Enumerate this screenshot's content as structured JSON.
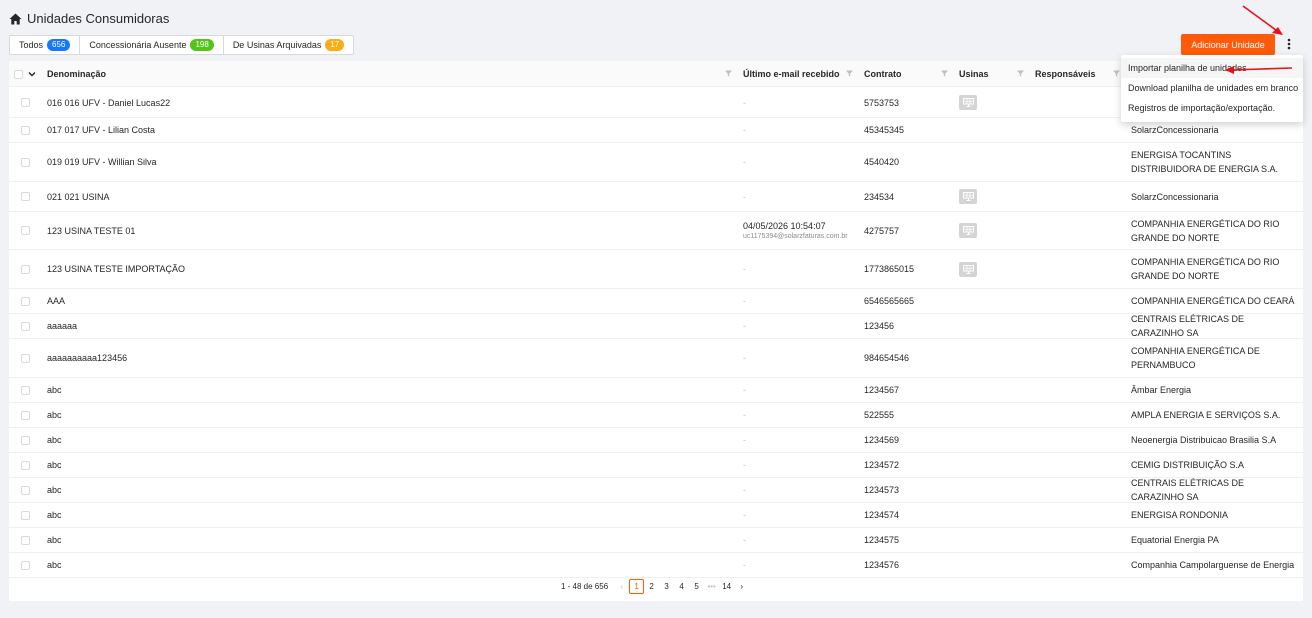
{
  "page": {
    "title": "Unidades Consumidoras",
    "home_icon": "home-icon"
  },
  "tabs": [
    {
      "label": "Todos",
      "count": "656",
      "color": "#1677ff"
    },
    {
      "label": "Concessionária Ausente",
      "count": "198",
      "color": "#52c41a"
    },
    {
      "label": "De Usinas Arquivadas",
      "count": "17",
      "color": "#faad14"
    }
  ],
  "toolbar": {
    "add_label": "Adicionar Unidade",
    "accent": "#ff5a0a"
  },
  "table": {
    "columns": {
      "name": "Denominação",
      "email": "Último e-mail recebido",
      "contract": "Contrato",
      "plants": "Usinas",
      "responsible": "Responsáveis"
    },
    "rows": [
      {
        "name": "016 016 UFV - Daniel Lucas22",
        "email": "-",
        "email_addr": "",
        "contract": "5753753",
        "usina": true,
        "dist": ""
      },
      {
        "name": "017 017 UFV - Lilian Costa",
        "email": "-",
        "email_addr": "",
        "contract": "45345345",
        "usina": false,
        "dist": "SolarzConcessionaria"
      },
      {
        "name": "019 019 UFV - Willian Silva",
        "email": "-",
        "email_addr": "",
        "contract": "4540420",
        "usina": false,
        "dist": "ENERGISA TOCANTINS DISTRIBUIDORA DE ENERGIA S.A."
      },
      {
        "name": "021 021 USINA",
        "email": "-",
        "email_addr": "",
        "contract": "234534",
        "usina": true,
        "dist": "SolarzConcessionaria"
      },
      {
        "name": "123 USINA TESTE 01",
        "email": "04/05/2026 10:54:07",
        "email_addr": "uc1175394@solarzfaturas.com.br",
        "contract": "4275757",
        "usina": true,
        "dist": "COMPANHIA ENERGÉTICA DO RIO GRANDE DO NORTE"
      },
      {
        "name": "123 USINA TESTE IMPORTAÇÃO",
        "email": "-",
        "email_addr": "",
        "contract": "1773865015",
        "usina": true,
        "dist": "COMPANHIA ENERGÉTICA DO RIO GRANDE DO NORTE"
      },
      {
        "name": "AAA",
        "email": "-",
        "email_addr": "",
        "contract": "6546565665",
        "usina": false,
        "dist": "COMPANHIA ENERGÉTICA DO CEARÁ"
      },
      {
        "name": "aaaaaa",
        "email": "-",
        "email_addr": "",
        "contract": "123456",
        "usina": false,
        "dist": "CENTRAIS ELÉTRICAS DE CARAZINHO SA"
      },
      {
        "name": "aaaaaaaaaa123456",
        "email": "-",
        "email_addr": "",
        "contract": "984654546",
        "usina": false,
        "dist": "COMPANHIA ENERGÉTICA DE PERNAMBUCO"
      },
      {
        "name": "abc",
        "email": "-",
        "email_addr": "",
        "contract": "1234567",
        "usina": false,
        "dist": "Âmbar Energia"
      },
      {
        "name": "abc",
        "email": "-",
        "email_addr": "",
        "contract": "522555",
        "usina": false,
        "dist": "AMPLA ENERGIA E SERVIÇOS S.A."
      },
      {
        "name": "abc",
        "email": "-",
        "email_addr": "",
        "contract": "1234569",
        "usina": false,
        "dist": "Neoenergia Distribuicao Brasilia S.A"
      },
      {
        "name": "abc",
        "email": "-",
        "email_addr": "",
        "contract": "1234572",
        "usina": false,
        "dist": "CEMIG DISTRIBUIÇÃO S.A"
      },
      {
        "name": "abc",
        "email": "-",
        "email_addr": "",
        "contract": "1234573",
        "usina": false,
        "dist": "CENTRAIS ELÉTRICAS DE CARAZINHO SA"
      },
      {
        "name": "abc",
        "email": "-",
        "email_addr": "",
        "contract": "1234574",
        "usina": false,
        "dist": "ENERGISA RONDONIA"
      },
      {
        "name": "abc",
        "email": "-",
        "email_addr": "",
        "contract": "1234575",
        "usina": false,
        "dist": "Equatorial Energia PA"
      },
      {
        "name": "abc",
        "email": "-",
        "email_addr": "",
        "contract": "1234576",
        "usina": false,
        "dist": "Companhia Campolarguense de Energia"
      }
    ]
  },
  "pagination": {
    "range": "1 - 48 de 656",
    "pages": [
      "1",
      "2",
      "3",
      "4",
      "5"
    ],
    "ellipsis": "•••",
    "last": "14",
    "current": "1"
  },
  "menu": {
    "items": [
      "Importar planilha de unidades",
      "Download planilha de unidades em branco",
      "Registros de importação/exportação."
    ]
  },
  "annotation_color": "#e8101a"
}
